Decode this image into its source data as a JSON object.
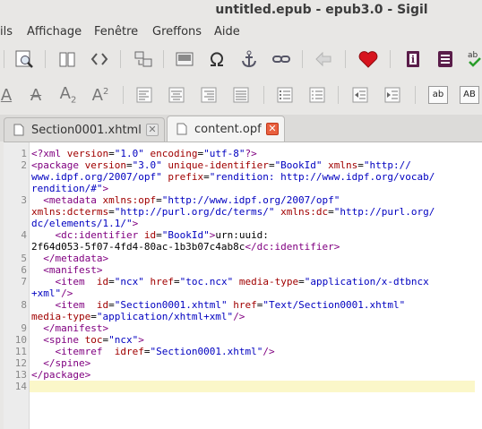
{
  "window": {
    "title": "untitled.epub - epub3.0 - Sigil"
  },
  "menu": {
    "items": [
      "ils",
      "Affichage",
      "Fenêtre",
      "Greffons",
      "Aide"
    ]
  },
  "tabs": [
    {
      "label": "Section0001.xhtml"
    },
    {
      "label": "content.opf"
    }
  ],
  "toolbar2": {
    "labels": [
      "A",
      "A",
      "A",
      "A",
      "ab",
      "AB"
    ]
  },
  "editor": {
    "current_line": 14,
    "lines": [
      {
        "n": "1",
        "parts": [
          [
            "t",
            "<?xml "
          ],
          [
            "a",
            "version"
          ],
          [
            "x",
            "="
          ],
          [
            "v",
            "\"1.0\""
          ],
          [
            "x",
            " "
          ],
          [
            "a",
            "encoding"
          ],
          [
            "x",
            "="
          ],
          [
            "v",
            "\"utf-8\""
          ],
          [
            "t",
            "?>"
          ]
        ]
      },
      {
        "n": "2",
        "parts": [
          [
            "t",
            "<package "
          ],
          [
            "a",
            "version"
          ],
          [
            "x",
            "="
          ],
          [
            "v",
            "\"3.0\""
          ],
          [
            "x",
            " "
          ],
          [
            "a",
            "unique-identifier"
          ],
          [
            "x",
            "="
          ],
          [
            "v",
            "\"BookId\""
          ],
          [
            "x",
            " "
          ],
          [
            "a",
            "xmlns"
          ],
          [
            "x",
            "="
          ],
          [
            "v",
            "\"http://"
          ]
        ]
      },
      {
        "n": "",
        "parts": [
          [
            "v",
            "www.idpf.org/2007/opf\""
          ],
          [
            "x",
            " "
          ],
          [
            "a",
            "prefix"
          ],
          [
            "x",
            "="
          ],
          [
            "v",
            "\"rendition: http://www.idpf.org/vocab/"
          ]
        ]
      },
      {
        "n": "",
        "parts": [
          [
            "v",
            "rendition/#\""
          ],
          [
            "t",
            ">"
          ]
        ]
      },
      {
        "n": "3",
        "parts": [
          [
            "x",
            "  "
          ],
          [
            "t",
            "<metadata "
          ],
          [
            "a",
            "xmlns:opf"
          ],
          [
            "x",
            "="
          ],
          [
            "v",
            "\"http://www.idpf.org/2007/opf\""
          ]
        ]
      },
      {
        "n": "",
        "parts": [
          [
            "a",
            "xmlns:dcterms"
          ],
          [
            "x",
            "="
          ],
          [
            "v",
            "\"http://purl.org/dc/terms/\""
          ],
          [
            "x",
            " "
          ],
          [
            "a",
            "xmlns:dc"
          ],
          [
            "x",
            "="
          ],
          [
            "v",
            "\"http://purl.org/"
          ]
        ]
      },
      {
        "n": "",
        "parts": [
          [
            "v",
            "dc/elements/1.1/\""
          ],
          [
            "t",
            ">"
          ]
        ]
      },
      {
        "n": "4",
        "parts": [
          [
            "x",
            "    "
          ],
          [
            "t",
            "<dc:identifier "
          ],
          [
            "a",
            "id"
          ],
          [
            "x",
            "="
          ],
          [
            "v",
            "\"BookId\""
          ],
          [
            "t",
            ">"
          ],
          [
            "x",
            "urn:uuid:"
          ]
        ]
      },
      {
        "n": "",
        "parts": [
          [
            "x",
            "2f64d053-5f07-4fd4-80ac-1b3b07c4ab8c"
          ],
          [
            "t",
            "</dc:identifier>"
          ]
        ]
      },
      {
        "n": "5",
        "parts": [
          [
            "x",
            "  "
          ],
          [
            "t",
            "</metadata>"
          ]
        ]
      },
      {
        "n": "6",
        "parts": [
          [
            "x",
            "  "
          ],
          [
            "t",
            "<manifest>"
          ]
        ]
      },
      {
        "n": "7",
        "parts": [
          [
            "x",
            "    "
          ],
          [
            "t",
            "<item "
          ],
          [
            "x",
            " "
          ],
          [
            "a",
            "id"
          ],
          [
            "x",
            "="
          ],
          [
            "v",
            "\"ncx\""
          ],
          [
            "x",
            " "
          ],
          [
            "a",
            "href"
          ],
          [
            "x",
            "="
          ],
          [
            "v",
            "\"toc.ncx\""
          ],
          [
            "x",
            " "
          ],
          [
            "a",
            "media-type"
          ],
          [
            "x",
            "="
          ],
          [
            "v",
            "\"application/x-dtbncx"
          ]
        ]
      },
      {
        "n": "",
        "parts": [
          [
            "v",
            "+xml\""
          ],
          [
            "t",
            "/>"
          ]
        ]
      },
      {
        "n": "8",
        "parts": [
          [
            "x",
            "    "
          ],
          [
            "t",
            "<item "
          ],
          [
            "x",
            " "
          ],
          [
            "a",
            "id"
          ],
          [
            "x",
            "="
          ],
          [
            "v",
            "\"Section0001.xhtml\""
          ],
          [
            "x",
            " "
          ],
          [
            "a",
            "href"
          ],
          [
            "x",
            "="
          ],
          [
            "v",
            "\"Text/Section0001.xhtml\""
          ]
        ]
      },
      {
        "n": "",
        "parts": [
          [
            "a",
            "media-type"
          ],
          [
            "x",
            "="
          ],
          [
            "v",
            "\"application/xhtml+xml\""
          ],
          [
            "t",
            "/>"
          ]
        ]
      },
      {
        "n": "9",
        "parts": [
          [
            "x",
            "  "
          ],
          [
            "t",
            "</manifest>"
          ]
        ]
      },
      {
        "n": "10",
        "parts": [
          [
            "x",
            "  "
          ],
          [
            "t",
            "<spine "
          ],
          [
            "a",
            "toc"
          ],
          [
            "x",
            "="
          ],
          [
            "v",
            "\"ncx\""
          ],
          [
            "t",
            ">"
          ]
        ]
      },
      {
        "n": "11",
        "parts": [
          [
            "x",
            "    "
          ],
          [
            "t",
            "<itemref "
          ],
          [
            "x",
            " "
          ],
          [
            "a",
            "idref"
          ],
          [
            "x",
            "="
          ],
          [
            "v",
            "\"Section0001.xhtml\""
          ],
          [
            "t",
            "/>"
          ]
        ]
      },
      {
        "n": "12",
        "parts": [
          [
            "x",
            "  "
          ],
          [
            "t",
            "</spine>"
          ]
        ]
      },
      {
        "n": "13",
        "parts": [
          [
            "t",
            "</package>"
          ]
        ]
      },
      {
        "n": "14",
        "parts": []
      }
    ]
  },
  "colors": {
    "tag": "#800080",
    "attribute": "#a00000",
    "value": "#0000c0",
    "current_line": "#fbf7c9",
    "close_active": "#e9603f"
  },
  "icons": {
    "toolbar1": [
      "save-icon",
      "find-replace-icon",
      "book-browser-icon",
      "code-view-icon",
      "split-icon",
      "insert-image-icon",
      "omega-special-char-icon",
      "anchor-icon",
      "link-icon",
      "back-arrow-icon",
      "heart-donate-icon",
      "metadata-editor-icon",
      "toc-icon",
      "spellcheck-icon"
    ],
    "toolbar2": [
      "underline-icon",
      "strikethrough-icon",
      "subscript-icon",
      "superscript-icon",
      "align-left-icon",
      "align-center-icon",
      "align-right-icon",
      "justify-icon",
      "bullet-list-icon",
      "numbered-list-icon",
      "decrease-indent-icon",
      "increase-indent-icon",
      "lowercase-icon",
      "uppercase-icon"
    ]
  }
}
